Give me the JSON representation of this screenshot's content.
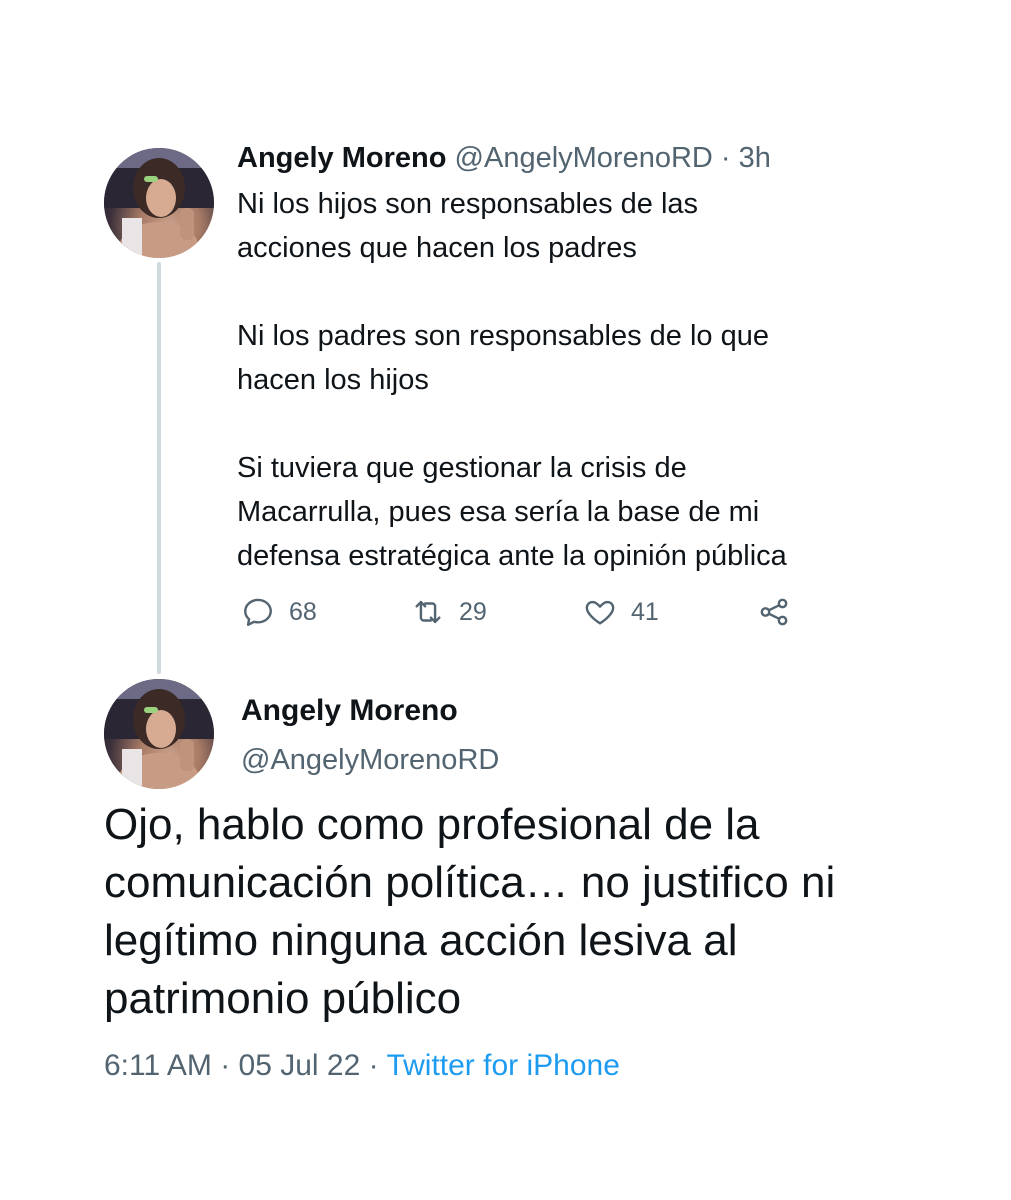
{
  "tweet1": {
    "display_name": "Angely Moreno",
    "handle": "@AngelyMorenoRD",
    "separator": "·",
    "time": "3h",
    "lines": [
      "Ni los hijos son responsables de las",
      "acciones que hacen los padres",
      "Ni los padres son responsables de lo que",
      "hacen los hijos",
      "Si tuviera que gestionar la crisis de",
      "Macarrulla, pues esa sería la base de mi",
      "defensa estratégica ante la opinión pública"
    ],
    "actions": {
      "reply_icon": "reply-icon",
      "reply_count": "68",
      "retweet_icon": "retweet-icon",
      "retweet_count": "29",
      "like_icon": "heart-icon",
      "like_count": "41",
      "share_icon": "share-icon"
    }
  },
  "tweet2": {
    "display_name": "Angely Moreno",
    "handle": "@AngelyMorenoRD",
    "lines": [
      "Ojo, hablo como profesional de la",
      "comunicación política… no justifico ni",
      "legítimo ninguna acción lesiva al",
      "patrimonio público"
    ],
    "time": "6:11 AM",
    "separator": "·",
    "date": "05 Jul 22",
    "source": "Twitter for iPhone"
  },
  "colors": {
    "text": "#0f1419",
    "muted": "#536471",
    "link": "#1d9bf0",
    "thread_line": "#cfd9de"
  }
}
